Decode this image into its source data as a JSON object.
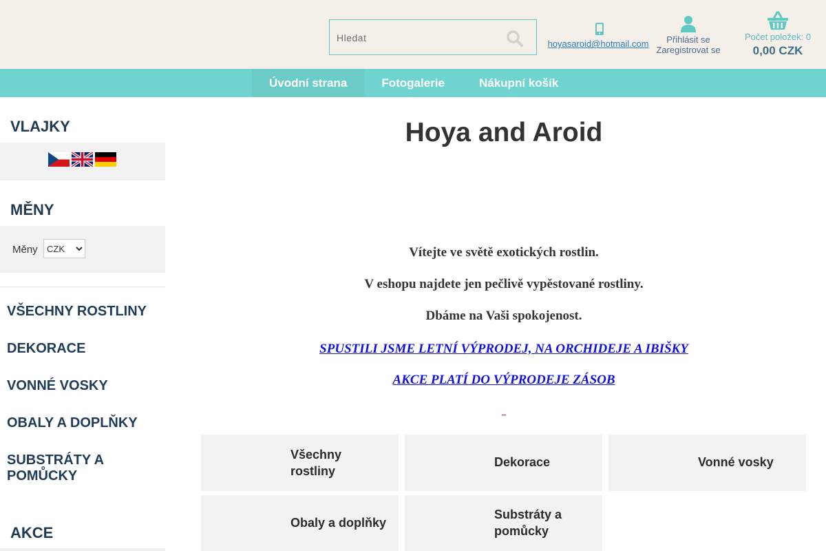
{
  "search": {
    "placeholder": "Hledat"
  },
  "contact": {
    "email": "hoyasaroid@hotmail.com"
  },
  "account": {
    "login": "Přihlásit se",
    "register": "Zaregistrovat se"
  },
  "cart": {
    "count_label": "Počet položek: 0",
    "total": "0,00 CZK"
  },
  "nav": {
    "items": [
      {
        "label": "Úvodní strana"
      },
      {
        "label": "Fotogalerie"
      },
      {
        "label": "Nákupní košík"
      }
    ]
  },
  "sidebar": {
    "flags_title": "VLAJKY",
    "currency_title": "MĚNY",
    "currency_label": "Měny",
    "currency_selected": "CZK",
    "categories": [
      {
        "label": "VŠECHNY ROSTLINY"
      },
      {
        "label": "DEKORACE"
      },
      {
        "label": "VONNÉ VOSKY"
      },
      {
        "label": "OBALY A DOPLŇKY"
      },
      {
        "label": "SUBSTRÁTY A POMŮCKY"
      }
    ],
    "akce_title": "AKCE"
  },
  "main": {
    "title": "Hoya and Aroid",
    "welcome_lines": [
      "Vítejte ve světě exotických rostlin.",
      "V eshopu najdete jen pečlivě vypěstované rostliny.",
      "Dbáme na Vaši spokojenost."
    ],
    "promo_lines": [
      "SPUSTILI JSME LETNÍ VÝPRODEJ, NA ORCHIDEJE A IBIŠKY",
      "AKCE PLATÍ DO VÝPRODEJE ZÁSOB "
    ],
    "tiles": [
      {
        "label": "Všechny rostliny"
      },
      {
        "label": "Dekorace"
      },
      {
        "label": "Vonné vosky"
      },
      {
        "label": "Obaly a doplňky"
      },
      {
        "label": "Substráty a pomůcky"
      }
    ]
  },
  "colors": {
    "nav_bg": "#6fd3cf",
    "header_bg": "#f5efe9",
    "heading": "#213a52",
    "promo": "#1010e0"
  },
  "icons": [
    "search-icon",
    "phone-icon",
    "user-icon",
    "basket-icon",
    "flag-cz-icon",
    "flag-gb-icon",
    "flag-de-icon"
  ]
}
